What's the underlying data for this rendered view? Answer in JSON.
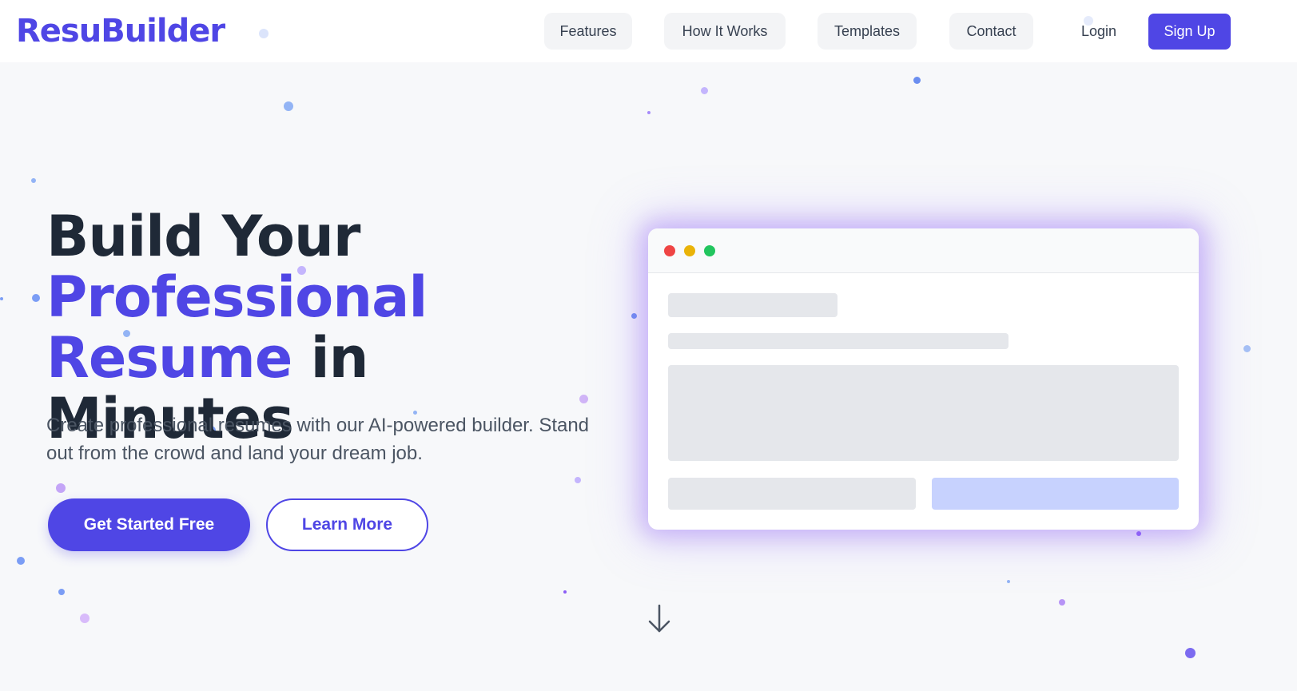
{
  "brand": {
    "name": "ResuBuilder"
  },
  "nav": {
    "items": [
      "Features",
      "How It Works",
      "Templates",
      "Contact"
    ],
    "login_label": "Login",
    "signup_label": "Sign Up"
  },
  "hero": {
    "title_line1": "Build Your",
    "title_accent1": "Professional",
    "title_accent2": "Resume",
    "title_rest": " in Minutes",
    "subtitle": "Create professional resumes with our AI-powered builder. Stand out from the crowd and land your dream job.",
    "primary_cta": "Get Started Free",
    "secondary_cta": "Learn More"
  },
  "mockup": {
    "window_dots": [
      "#ef4444",
      "#eab308",
      "#22c55e"
    ]
  },
  "icons": {
    "scroll_indicator": "arrow-down-icon"
  },
  "colors": {
    "accent": "#4f46e5",
    "text_dark": "#1f2937",
    "text_muted": "#4b5563",
    "background": "#f7f8fa"
  }
}
